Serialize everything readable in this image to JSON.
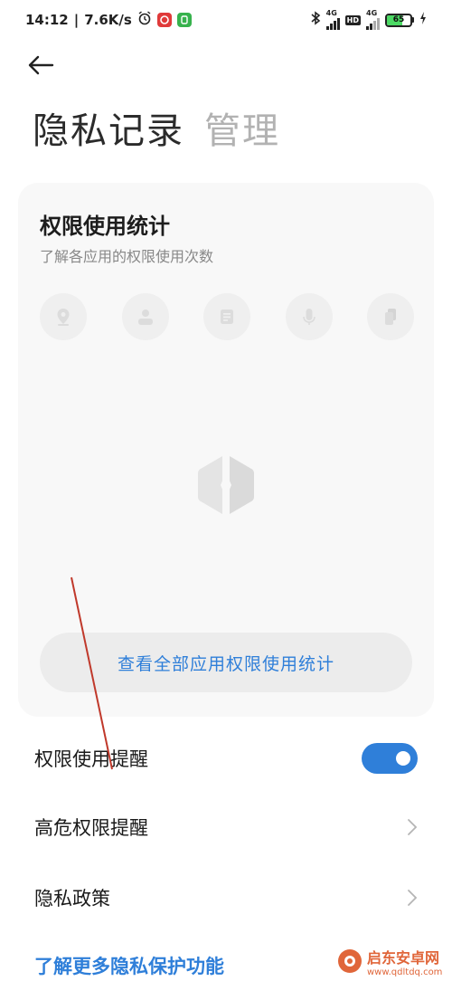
{
  "status_bar": {
    "time": "14:12",
    "speed": "7.6K/s",
    "net_label_1": "4G",
    "net_label_2": "4G",
    "hd_label": "HD",
    "battery_level": 65,
    "battery_text": "65"
  },
  "header": {
    "title_main": "隐私记录",
    "title_sub": "管理"
  },
  "card": {
    "title": "权限使用统计",
    "subtitle": "了解各应用的权限使用次数",
    "permission_icons": [
      "location-icon",
      "contacts-icon",
      "messages-icon",
      "microphone-icon",
      "clipboard-icon"
    ],
    "button_label": "查看全部应用权限使用统计"
  },
  "settings": {
    "usage_reminder_label": "权限使用提醒",
    "usage_reminder_on": true,
    "high_risk_label": "高危权限提醒",
    "privacy_policy_label": "隐私政策",
    "more_link": "了解更多隐私保护功能"
  },
  "watermark": {
    "name": "启东安卓网",
    "url": "www.qdltdq.com"
  },
  "colors": {
    "accent": "#2f7fd9",
    "battery": "#4cd964",
    "watermark": "#e0663a"
  }
}
